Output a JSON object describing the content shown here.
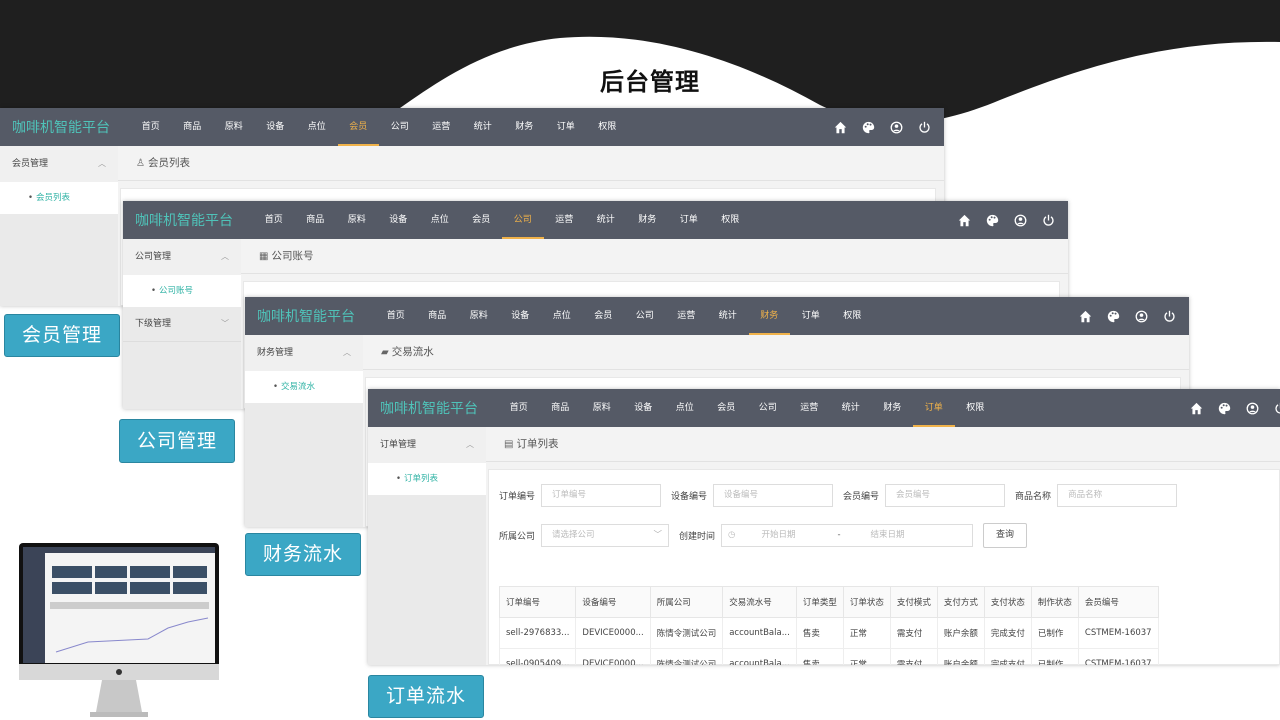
{
  "slide_title": "后台管理",
  "brand": "咖啡机智能平台",
  "nav_items": [
    "首页",
    "商品",
    "原料",
    "设备",
    "点位",
    "会员",
    "公司",
    "运营",
    "统计",
    "财务",
    "订单",
    "权限"
  ],
  "topbar_icons": [
    "home-icon",
    "palette-icon",
    "user-circle-icon",
    "power-icon"
  ],
  "panels": {
    "member": {
      "active_nav": "会员",
      "sidebar_group": "会员管理",
      "sidebar_item": "会员列表",
      "crumb": "会员列表",
      "tag": "会员管理"
    },
    "company": {
      "active_nav": "公司",
      "sidebar_group": "公司管理",
      "sidebar_item": "公司账号",
      "sidebar_group2": "下级管理",
      "crumb": "公司账号",
      "tag": "公司管理"
    },
    "finance": {
      "active_nav": "财务",
      "sidebar_group": "财务管理",
      "sidebar_item": "交易流水",
      "crumb": "交易流水",
      "tag": "财务流水"
    },
    "order": {
      "active_nav": "订单",
      "sidebar_group": "订单管理",
      "sidebar_item": "订单列表",
      "crumb": "订单列表",
      "tag": "订单流水",
      "filters": {
        "order_no": {
          "label": "订单编号",
          "placeholder": "订单编号"
        },
        "device_no": {
          "label": "设备编号",
          "placeholder": "设备编号"
        },
        "member_no": {
          "label": "会员编号",
          "placeholder": "会员编号"
        },
        "product_name": {
          "label": "商品名称",
          "placeholder": "商品名称"
        },
        "company": {
          "label": "所属公司",
          "placeholder": "请选择公司"
        },
        "created": {
          "label": "创建时间",
          "start_placeholder": "开始日期",
          "separator": "-",
          "end_placeholder": "结束日期"
        },
        "query_button": "查询"
      },
      "table": {
        "headers": [
          "订单编号",
          "设备编号",
          "所属公司",
          "交易流水号",
          "订单类型",
          "订单状态",
          "支付模式",
          "支付方式",
          "支付状态",
          "制作状态",
          "会员编号"
        ],
        "rows": [
          [
            "sell-2976833...",
            "DEVICE0000...",
            "陈情令测试公司",
            "accountBala...",
            "售卖",
            "正常",
            "需支付",
            "账户余额",
            "完成支付",
            "已制作",
            "CSTMEM-16037"
          ],
          [
            "sell-0905409...",
            "DEVICE0000...",
            "陈情令测试公司",
            "accountBala...",
            "售卖",
            "正常",
            "需支付",
            "账户余额",
            "完成支付",
            "已制作",
            "CSTMEM-16037"
          ]
        ]
      }
    }
  },
  "colors": {
    "topbar": "#555a66",
    "brand": "#4fc3b9",
    "active_nav": "#f0b24a",
    "tag_bg": "#3ba7c5",
    "sidebar_link": "#30b3a5"
  }
}
